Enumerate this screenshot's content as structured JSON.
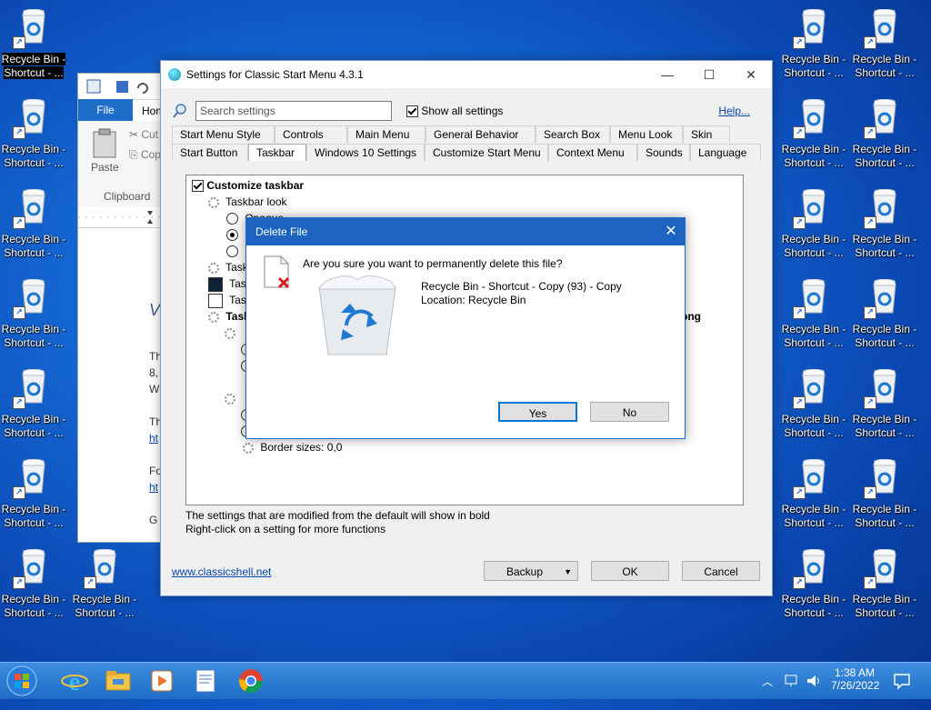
{
  "desktop": {
    "icon_label_line1": "Recycle Bin -",
    "icon_label_line2": "Shortcut - ...",
    "selected_label_line1": "Recycle Bin -",
    "selected_label_line2": "Shortcut - ..."
  },
  "wordpad": {
    "file_tab": "File",
    "home_tab": "Hom",
    "paste_label": "Paste",
    "cut_label": "Cut",
    "copy_label": "Cop",
    "clipboard_label": "Clipboard",
    "doc_lines": [
      "V",
      "Th",
      "8,",
      "W",
      "Th",
      "ht",
      "Fo",
      "ht",
      "G"
    ]
  },
  "settings": {
    "title": "Settings for Classic Start Menu 4.3.1",
    "search_placeholder": "Search settings",
    "show_all_label": "Show all settings",
    "help_label": "Help...",
    "tabs_row1": [
      "Start Menu Style",
      "Controls",
      "Main Menu",
      "General Behavior",
      "Search Box",
      "Menu Look",
      "Skin"
    ],
    "tabs_row2": [
      "Start Button",
      "Taskbar",
      "Windows 10 Settings",
      "Customize Start Menu",
      "Context Menu",
      "Sounds",
      "Language"
    ],
    "active_tab": "Taskbar",
    "tree": {
      "customize_taskbar": "Customize taskbar",
      "taskbar_look": "Taskbar look",
      "opaque": "Opaque",
      "task1": "Task",
      "task2": "Task",
      "task3": "Task",
      "task4": "Task",
      "png_suffix": "png",
      "border_sizes": "Border sizes: 0,0"
    },
    "hint1": "The settings that are modified from the default will show in bold",
    "hint2": "Right-click on a setting for more functions",
    "link": "www.classicshell.net",
    "backup": "Backup",
    "ok": "OK",
    "cancel": "Cancel"
  },
  "dialog": {
    "title": "Delete File",
    "question": "Are you sure you want to permanently delete this file?",
    "file_name": "Recycle Bin - Shortcut - Copy (93) - Copy",
    "location": "Location: Recycle Bin",
    "yes": "Yes",
    "no": "No"
  },
  "taskbar": {
    "time": "1:38 AM",
    "date": "7/26/2022"
  },
  "colors": {
    "accent": "#1c64c0",
    "desktop": "#1466d2"
  }
}
